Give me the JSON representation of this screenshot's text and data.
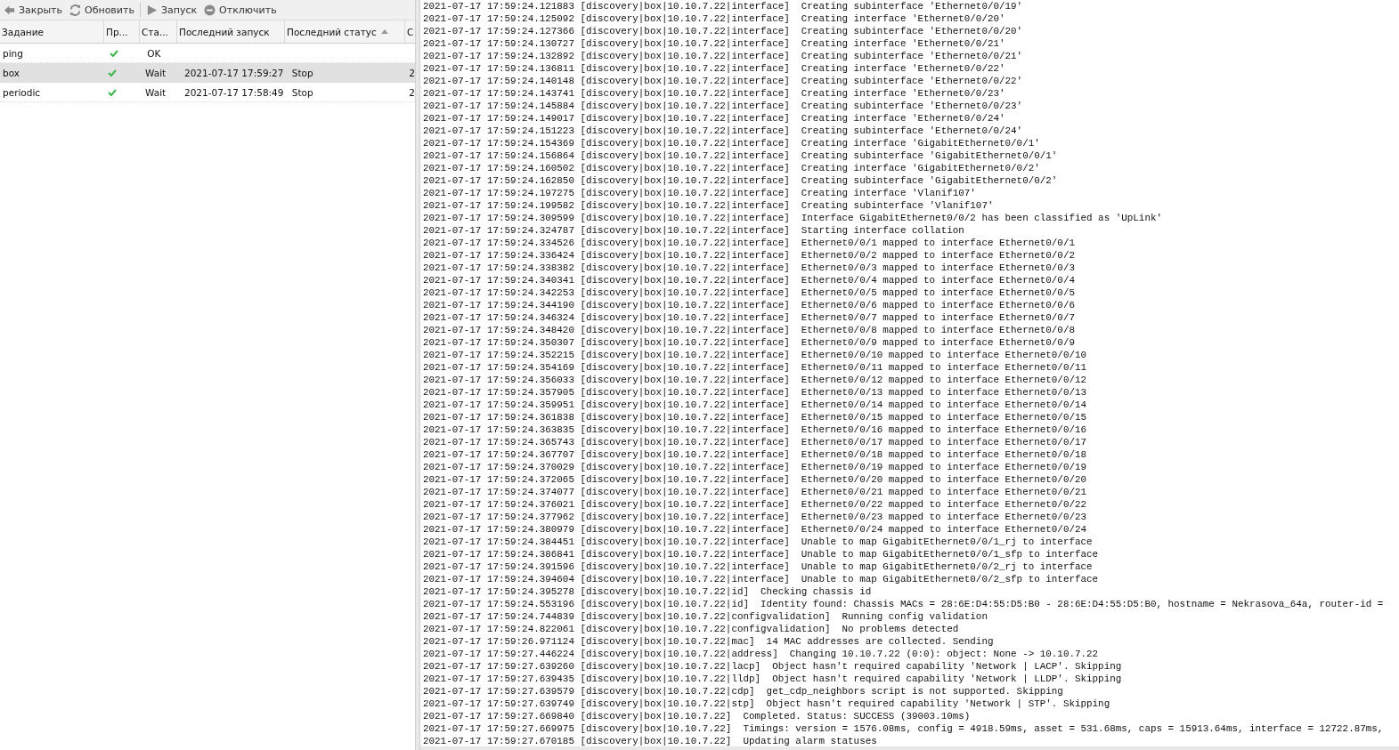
{
  "toolbar": [
    {
      "kind": "back",
      "label": "Закрыть"
    },
    {
      "kind": "refresh",
      "label": "Обновить"
    },
    {
      "kind": "run",
      "label": "Запуск"
    },
    {
      "kind": "disable",
      "label": "Отключить"
    }
  ],
  "table": {
    "columns": [
      {
        "label": "Задание",
        "sorted": false
      },
      {
        "label": "Пр...",
        "sorted": false
      },
      {
        "label": "Ста...",
        "sorted": false
      },
      {
        "label": "Последний запуск",
        "sorted": false
      },
      {
        "label": "Последний статус",
        "sorted": true
      },
      {
        "label": "С",
        "sorted": false
      }
    ],
    "rows": [
      {
        "name": "ping",
        "checked": true,
        "status": "OK",
        "last_run": "",
        "last_status": "",
        "column_6": "",
        "selected": false
      },
      {
        "name": "box",
        "checked": true,
        "status": "Wait",
        "last_run": "2021-07-17 17:59:27",
        "last_status": "Stop",
        "column_6": "2",
        "selected": true
      },
      {
        "name": "periodic",
        "checked": true,
        "status": "Wait",
        "last_run": "2021-07-17 17:58:49",
        "last_status": "Stop",
        "column_6": "2",
        "selected": false
      }
    ]
  },
  "log": [
    "2021-07-17 17:59:24.121883 [discovery|box|10.10.7.22|interface]  Creating subinterface 'Ethernet0/0/19'",
    "2021-07-17 17:59:24.125092 [discovery|box|10.10.7.22|interface]  Creating interface 'Ethernet0/0/20'",
    "2021-07-17 17:59:24.127366 [discovery|box|10.10.7.22|interface]  Creating subinterface 'Ethernet0/0/20'",
    "2021-07-17 17:59:24.130727 [discovery|box|10.10.7.22|interface]  Creating interface 'Ethernet0/0/21'",
    "2021-07-17 17:59:24.132892 [discovery|box|10.10.7.22|interface]  Creating subinterface 'Ethernet0/0/21'",
    "2021-07-17 17:59:24.136811 [discovery|box|10.10.7.22|interface]  Creating interface 'Ethernet0/0/22'",
    "2021-07-17 17:59:24.140148 [discovery|box|10.10.7.22|interface]  Creating subinterface 'Ethernet0/0/22'",
    "2021-07-17 17:59:24.143741 [discovery|box|10.10.7.22|interface]  Creating interface 'Ethernet0/0/23'",
    "2021-07-17 17:59:24.145884 [discovery|box|10.10.7.22|interface]  Creating subinterface 'Ethernet0/0/23'",
    "2021-07-17 17:59:24.149017 [discovery|box|10.10.7.22|interface]  Creating interface 'Ethernet0/0/24'",
    "2021-07-17 17:59:24.151223 [discovery|box|10.10.7.22|interface]  Creating subinterface 'Ethernet0/0/24'",
    "2021-07-17 17:59:24.154369 [discovery|box|10.10.7.22|interface]  Creating interface 'GigabitEthernet0/0/1'",
    "2021-07-17 17:59:24.156864 [discovery|box|10.10.7.22|interface]  Creating subinterface 'GigabitEthernet0/0/1'",
    "2021-07-17 17:59:24.160502 [discovery|box|10.10.7.22|interface]  Creating interface 'GigabitEthernet0/0/2'",
    "2021-07-17 17:59:24.162850 [discovery|box|10.10.7.22|interface]  Creating subinterface 'GigabitEthernet0/0/2'",
    "2021-07-17 17:59:24.197275 [discovery|box|10.10.7.22|interface]  Creating interface 'Vlanif107'",
    "2021-07-17 17:59:24.199582 [discovery|box|10.10.7.22|interface]  Creating subinterface 'Vlanif107'",
    "2021-07-17 17:59:24.309599 [discovery|box|10.10.7.22|interface]  Interface GigabitEthernet0/0/2 has been classified as 'UpLink'",
    "2021-07-17 17:59:24.324787 [discovery|box|10.10.7.22|interface]  Starting interface collation",
    "2021-07-17 17:59:24.334526 [discovery|box|10.10.7.22|interface]  Ethernet0/0/1 mapped to interface Ethernet0/0/1",
    "2021-07-17 17:59:24.336424 [discovery|box|10.10.7.22|interface]  Ethernet0/0/2 mapped to interface Ethernet0/0/2",
    "2021-07-17 17:59:24.338382 [discovery|box|10.10.7.22|interface]  Ethernet0/0/3 mapped to interface Ethernet0/0/3",
    "2021-07-17 17:59:24.340341 [discovery|box|10.10.7.22|interface]  Ethernet0/0/4 mapped to interface Ethernet0/0/4",
    "2021-07-17 17:59:24.342253 [discovery|box|10.10.7.22|interface]  Ethernet0/0/5 mapped to interface Ethernet0/0/5",
    "2021-07-17 17:59:24.344190 [discovery|box|10.10.7.22|interface]  Ethernet0/0/6 mapped to interface Ethernet0/0/6",
    "2021-07-17 17:59:24.346324 [discovery|box|10.10.7.22|interface]  Ethernet0/0/7 mapped to interface Ethernet0/0/7",
    "2021-07-17 17:59:24.348420 [discovery|box|10.10.7.22|interface]  Ethernet0/0/8 mapped to interface Ethernet0/0/8",
    "2021-07-17 17:59:24.350307 [discovery|box|10.10.7.22|interface]  Ethernet0/0/9 mapped to interface Ethernet0/0/9",
    "2021-07-17 17:59:24.352215 [discovery|box|10.10.7.22|interface]  Ethernet0/0/10 mapped to interface Ethernet0/0/10",
    "2021-07-17 17:59:24.354169 [discovery|box|10.10.7.22|interface]  Ethernet0/0/11 mapped to interface Ethernet0/0/11",
    "2021-07-17 17:59:24.356033 [discovery|box|10.10.7.22|interface]  Ethernet0/0/12 mapped to interface Ethernet0/0/12",
    "2021-07-17 17:59:24.357905 [discovery|box|10.10.7.22|interface]  Ethernet0/0/13 mapped to interface Ethernet0/0/13",
    "2021-07-17 17:59:24.359951 [discovery|box|10.10.7.22|interface]  Ethernet0/0/14 mapped to interface Ethernet0/0/14",
    "2021-07-17 17:59:24.361838 [discovery|box|10.10.7.22|interface]  Ethernet0/0/15 mapped to interface Ethernet0/0/15",
    "2021-07-17 17:59:24.363835 [discovery|box|10.10.7.22|interface]  Ethernet0/0/16 mapped to interface Ethernet0/0/16",
    "2021-07-17 17:59:24.365743 [discovery|box|10.10.7.22|interface]  Ethernet0/0/17 mapped to interface Ethernet0/0/17",
    "2021-07-17 17:59:24.367707 [discovery|box|10.10.7.22|interface]  Ethernet0/0/18 mapped to interface Ethernet0/0/18",
    "2021-07-17 17:59:24.370029 [discovery|box|10.10.7.22|interface]  Ethernet0/0/19 mapped to interface Ethernet0/0/19",
    "2021-07-17 17:59:24.372065 [discovery|box|10.10.7.22|interface]  Ethernet0/0/20 mapped to interface Ethernet0/0/20",
    "2021-07-17 17:59:24.374077 [discovery|box|10.10.7.22|interface]  Ethernet0/0/21 mapped to interface Ethernet0/0/21",
    "2021-07-17 17:59:24.376021 [discovery|box|10.10.7.22|interface]  Ethernet0/0/22 mapped to interface Ethernet0/0/22",
    "2021-07-17 17:59:24.377962 [discovery|box|10.10.7.22|interface]  Ethernet0/0/23 mapped to interface Ethernet0/0/23",
    "2021-07-17 17:59:24.380979 [discovery|box|10.10.7.22|interface]  Ethernet0/0/24 mapped to interface Ethernet0/0/24",
    "2021-07-17 17:59:24.384451 [discovery|box|10.10.7.22|interface]  Unable to map GigabitEthernet0/0/1_rj to interface",
    "2021-07-17 17:59:24.386841 [discovery|box|10.10.7.22|interface]  Unable to map GigabitEthernet0/0/1_sfp to interface",
    "2021-07-17 17:59:24.391596 [discovery|box|10.10.7.22|interface]  Unable to map GigabitEthernet0/0/2_rj to interface",
    "2021-07-17 17:59:24.394604 [discovery|box|10.10.7.22|interface]  Unable to map GigabitEthernet0/0/2_sfp to interface",
    "2021-07-17 17:59:24.395278 [discovery|box|10.10.7.22|id]  Checking chassis id",
    "2021-07-17 17:59:24.553196 [discovery|box|10.10.7.22|id]  Identity found: Chassis MACs = 28:6E:D4:55:D5:B0 - 28:6E:D4:55:D5:B0, hostname = Nekrasova_64a, router-id =",
    "2021-07-17 17:59:24.744839 [discovery|box|10.10.7.22|configvalidation]  Running config validation",
    "2021-07-17 17:59:24.822061 [discovery|box|10.10.7.22|configvalidation]  No problems detected",
    "2021-07-17 17:59:26.971124 [discovery|box|10.10.7.22|mac]  14 MAC addresses are collected. Sending",
    "2021-07-17 17:59:27.446224 [discovery|box|10.10.7.22|address]  Changing 10.10.7.22 (0:0): object: None -> 10.10.7.22",
    "2021-07-17 17:59:27.639260 [discovery|box|10.10.7.22|lacp]  Object hasn't required capability 'Network | LACP'. Skipping",
    "2021-07-17 17:59:27.639435 [discovery|box|10.10.7.22|lldp]  Object hasn't required capability 'Network | LLDP'. Skipping",
    "2021-07-17 17:59:27.639579 [discovery|box|10.10.7.22|cdp]  get_cdp_neighbors script is not supported. Skipping",
    "2021-07-17 17:59:27.639749 [discovery|box|10.10.7.22|stp]  Object hasn't required capability 'Network | STP'. Skipping",
    "2021-07-17 17:59:27.669840 [discovery|box|10.10.7.22]  Completed. Status: SUCCESS (39003.10ms)",
    "2021-07-17 17:59:27.669975 [discovery|box|10.10.7.22]  Timings: version = 1576.08ms, config = 4918.59ms, asset = 531.68ms, caps = 15913.64ms, interface = 12722.87ms,",
    "2021-07-17 17:59:27.670185 [discovery|box|10.10.7.22]  Updating alarm statuses"
  ]
}
